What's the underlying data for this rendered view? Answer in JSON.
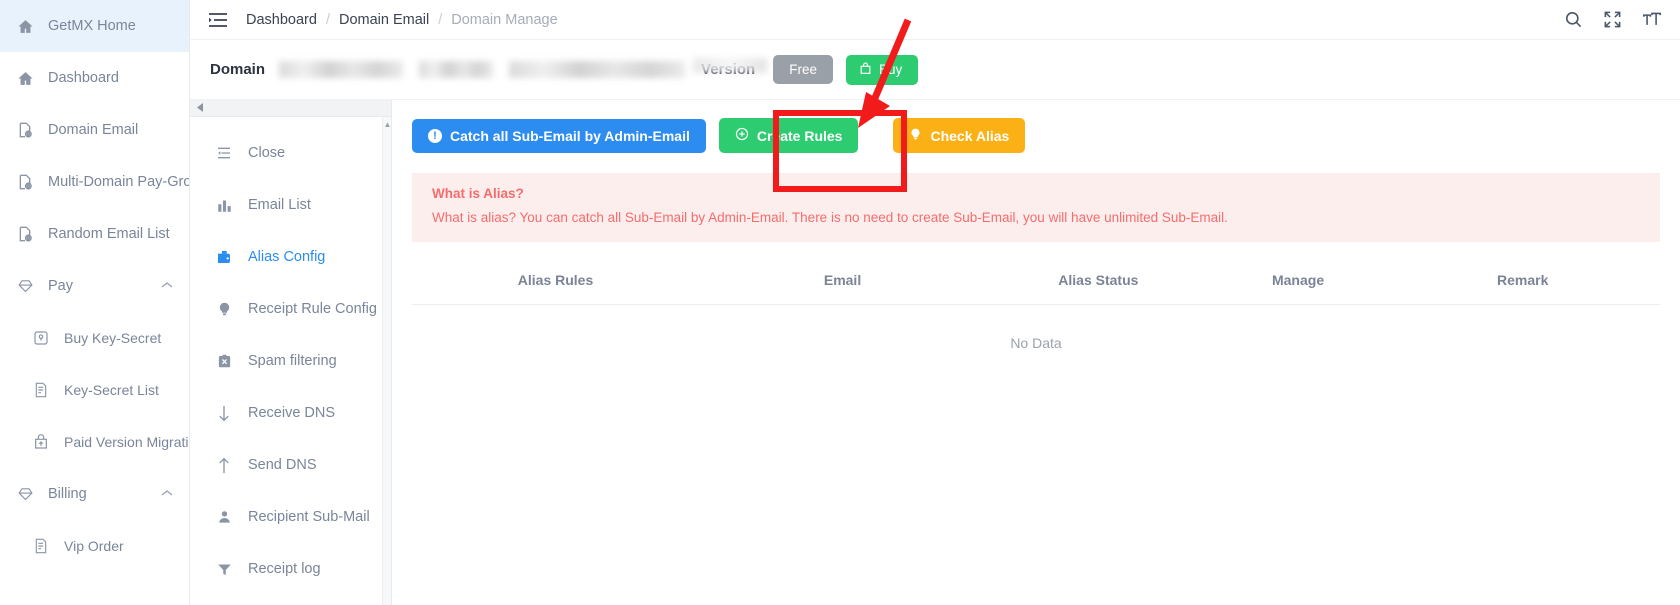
{
  "sidebar": {
    "items": [
      {
        "label": "GetMX Home",
        "icon": "home-icon",
        "active": true,
        "level": "top"
      },
      {
        "label": "Dashboard",
        "icon": "home-icon",
        "active": false,
        "level": "top"
      },
      {
        "label": "Domain Email",
        "icon": "globe-doc-icon",
        "active": false,
        "level": "top"
      },
      {
        "label": "Multi-Domain Pay-Group",
        "icon": "globe-doc-icon",
        "active": false,
        "level": "top"
      },
      {
        "label": "Random Email List",
        "icon": "globe-doc-icon",
        "active": false,
        "level": "top"
      },
      {
        "label": "Pay",
        "icon": "diamond-icon",
        "active": false,
        "level": "group",
        "caret": "chevron-up-icon"
      },
      {
        "label": "Buy Key-Secret",
        "icon": "key-box-icon",
        "active": false,
        "level": "sub"
      },
      {
        "label": "Key-Secret List",
        "icon": "list-doc-icon",
        "active": false,
        "level": "sub"
      },
      {
        "label": "Paid Version Migration",
        "icon": "upload-bag-icon",
        "active": false,
        "level": "sub"
      },
      {
        "label": "Billing",
        "icon": "diamond-icon",
        "active": false,
        "level": "group",
        "caret": "chevron-up-icon"
      },
      {
        "label": "Vip Order",
        "icon": "list-doc-icon",
        "active": false,
        "level": "sub"
      }
    ]
  },
  "topbar": {
    "menu_icon": "hamburger-collapse-icon",
    "breadcrumbs": [
      "Dashboard",
      "Domain Email",
      "Domain Manage"
    ],
    "separator": "/",
    "icons": [
      "search-icon",
      "fullscreen-icon",
      "font-size-icon"
    ]
  },
  "domain_bar": {
    "domain_label": "Domain",
    "domain_value": "",
    "version_label": "Version",
    "free_badge": "Free",
    "buy_label": "Buy",
    "buy_icon": "shopping-bag-icon"
  },
  "subnav": {
    "collapse_icon": "chevron-left-icon",
    "scroll_up_icon": "caret-up-icon",
    "items": [
      {
        "label": "Close",
        "icon": "close-list-icon",
        "active": false
      },
      {
        "label": "Email List",
        "icon": "bar-chart-icon",
        "active": false
      },
      {
        "label": "Alias Config",
        "icon": "wallet-icon",
        "active": true
      },
      {
        "label": "Receipt Rule Config",
        "icon": "bulb-icon",
        "active": false
      },
      {
        "label": "Spam filtering",
        "icon": "spam-block-icon",
        "active": false
      },
      {
        "label": "Receive DNS",
        "icon": "arrow-down-icon",
        "active": false
      },
      {
        "label": "Send DNS",
        "icon": "arrow-up-icon",
        "active": false
      },
      {
        "label": "Recipient Sub-Mail",
        "icon": "user-icon",
        "active": false
      },
      {
        "label": "Receipt log",
        "icon": "funnel-icon",
        "active": false
      }
    ]
  },
  "content": {
    "buttons": [
      {
        "label": "Catch all Sub-Email by Admin-Email",
        "color": "#2d8cf0",
        "icon": "exclamation-circle-icon"
      },
      {
        "label": "Create Rules",
        "color": "#2ecc71",
        "icon": "plus-circle-icon"
      },
      {
        "label": "Check Alias",
        "color": "#fbb116",
        "icon": "bulb-icon"
      }
    ],
    "alert": {
      "title": "What is Alias?",
      "text": "What is alias? You can catch all Sub-Email by Admin-Email. There is no need to create Sub-Email, you will have unlimited Sub-Email.",
      "color": "#f56c6c",
      "background": "#fdeeee"
    },
    "table": {
      "headers": [
        "Alias Rules",
        "Email",
        "Alias Status",
        "Manage",
        "Remark"
      ],
      "empty_text": "No Data",
      "rows": []
    }
  },
  "annotation": {
    "highlight_color": "#f21b1b",
    "highlight_target": "Check Alias",
    "arrow": "red-arrow-pointing-to-check-alias"
  }
}
